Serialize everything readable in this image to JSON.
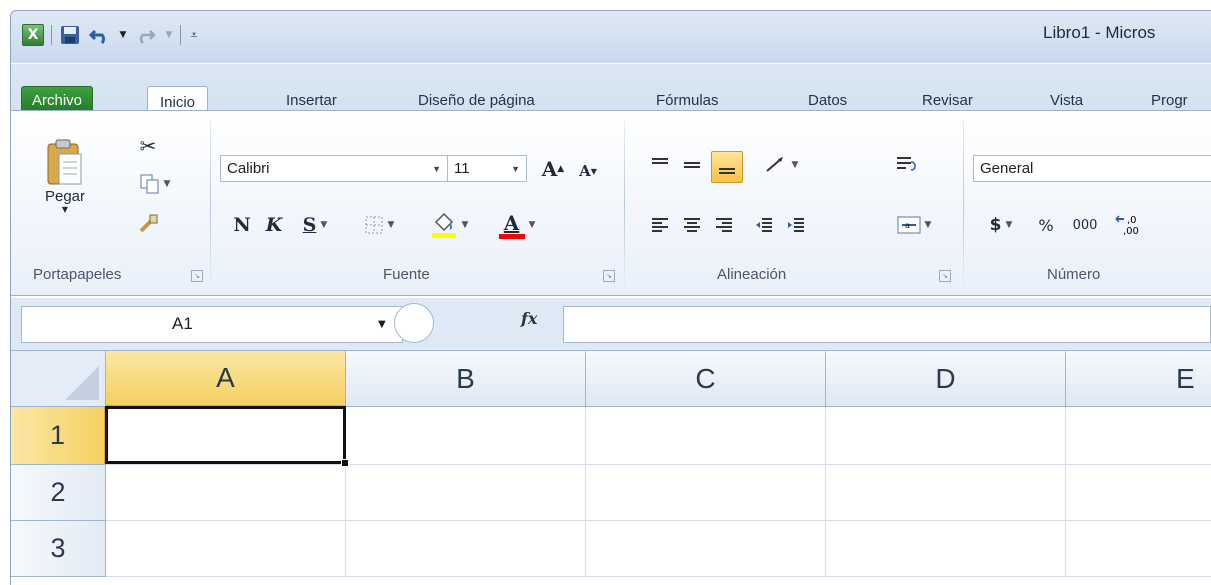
{
  "window": {
    "title": "Libro1 - Micros"
  },
  "quick_access": {
    "icons": [
      "excel-logo-icon",
      "save-icon",
      "undo-icon",
      "redo-icon",
      "customize-qat-icon"
    ]
  },
  "tabs": [
    {
      "label": "Archivo"
    },
    {
      "label": "Inicio",
      "active": true
    },
    {
      "label": "Insertar"
    },
    {
      "label": "Diseño de página"
    },
    {
      "label": "Fórmulas"
    },
    {
      "label": "Datos"
    },
    {
      "label": "Revisar"
    },
    {
      "label": "Vista"
    },
    {
      "label": "Progr"
    }
  ],
  "ribbon": {
    "clipboard": {
      "paste_label": "Pegar",
      "group_label": "Portapapeles"
    },
    "font": {
      "font_name": "Calibri",
      "font_size": "11",
      "bold": "N",
      "italic": "K",
      "underline": "S",
      "grow": "A",
      "shrink": "A",
      "font_color_letter": "A",
      "group_label": "Fuente"
    },
    "alignment": {
      "group_label": "Alineación"
    },
    "number": {
      "format": "General",
      "currency": "$",
      "percent": "%",
      "thousands": "000",
      "decimals": "←,0 ,00",
      "group_label": "Número"
    }
  },
  "formula_bar": {
    "name_box": "A1",
    "fx": "fx",
    "formula": ""
  },
  "sheet": {
    "columns": [
      "A",
      "B",
      "C",
      "D",
      "E"
    ],
    "rows": [
      "1",
      "2",
      "3"
    ],
    "selected_cell": "A1"
  },
  "colors": {
    "archivo_tab": "#1f7b26",
    "selected_header": "#f5cf61",
    "fill_yellow": "#ffff00",
    "font_red": "#ff0000"
  }
}
